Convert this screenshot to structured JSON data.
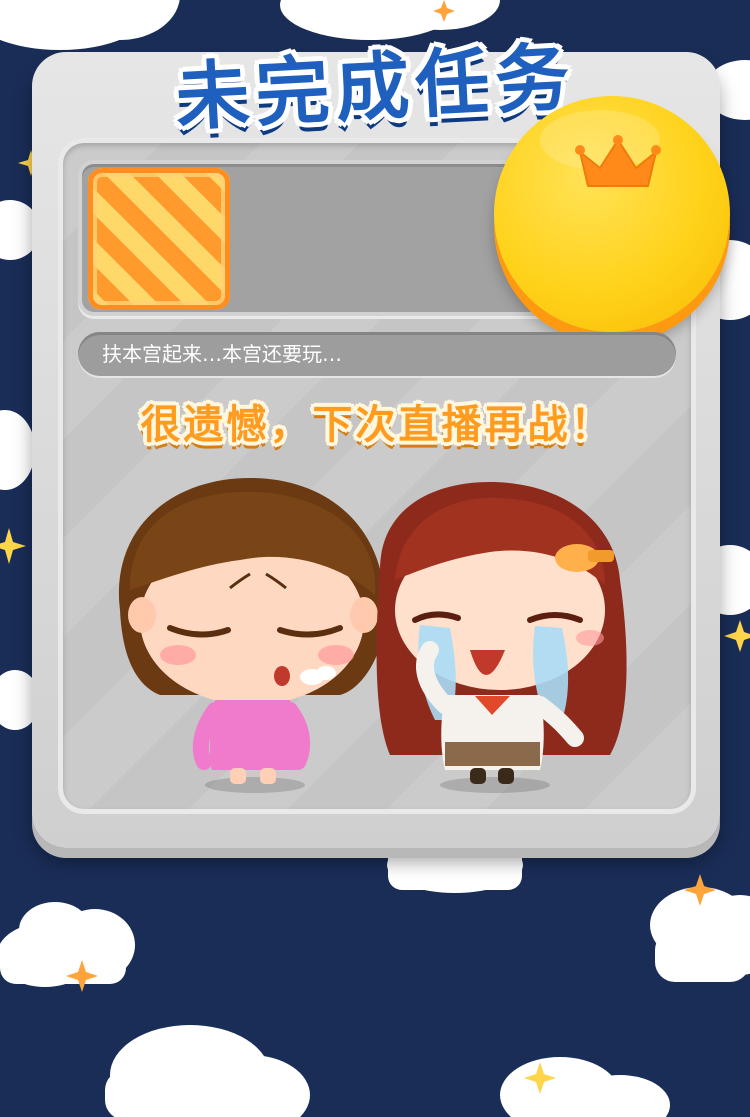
{
  "header": {
    "title": "未完成任务"
  },
  "reward": {
    "coin_icon": "crown-coin-icon",
    "item_icon": "mystery-box-icon"
  },
  "hint": {
    "text": "扶本宫起来…本宫还要玩…"
  },
  "result": {
    "message": "很遗憾，下次直播再战！"
  },
  "colors": {
    "background": "#1a2d57",
    "title": "#1f5fbd",
    "message": "#ff9c1f",
    "coin": "#ffd21a"
  }
}
